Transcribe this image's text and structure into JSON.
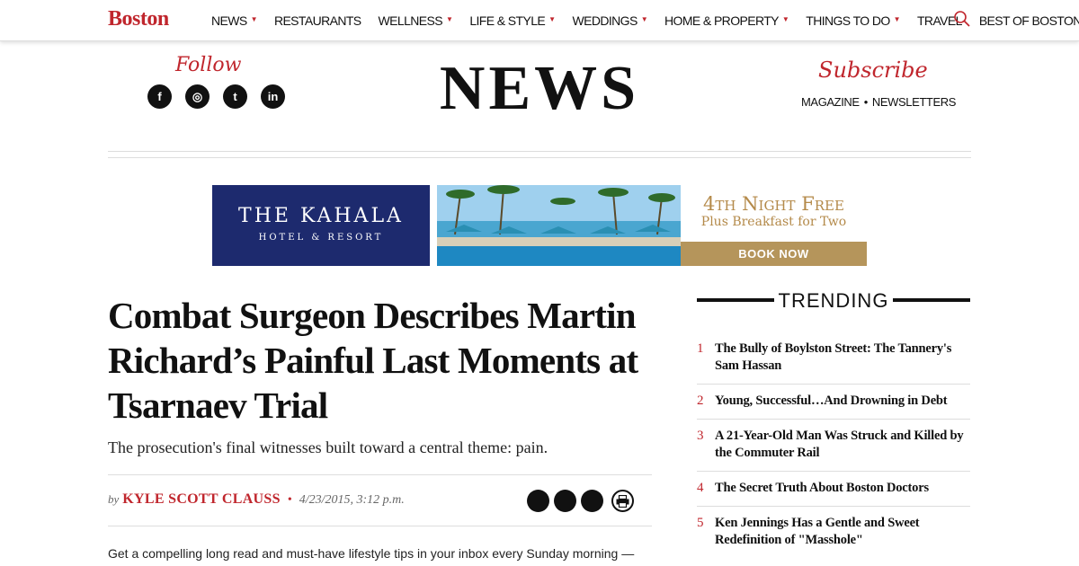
{
  "nav": {
    "logo": "Boston",
    "items": [
      {
        "label": "NEWS",
        "dropdown": true
      },
      {
        "label": "RESTAURANTS",
        "dropdown": false
      },
      {
        "label": "WELLNESS",
        "dropdown": true
      },
      {
        "label": "LIFE & STYLE",
        "dropdown": true
      },
      {
        "label": "WEDDINGS",
        "dropdown": true
      },
      {
        "label": "HOME & PROPERTY",
        "dropdown": true
      },
      {
        "label": "THINGS TO DO",
        "dropdown": true
      },
      {
        "label": "TRAVEL",
        "dropdown": false
      },
      {
        "label": "BEST OF BOSTON",
        "dropdown": false
      }
    ],
    "search_icon": "search-icon",
    "accent_color": "#c0262d"
  },
  "header": {
    "follow_label": "Follow",
    "social": [
      {
        "icon": "facebook-icon",
        "glyph": "f"
      },
      {
        "icon": "instagram-icon",
        "glyph": "◎"
      },
      {
        "icon": "twitter-icon",
        "glyph": "t"
      },
      {
        "icon": "linkedin-icon",
        "glyph": "in"
      }
    ],
    "section_title": "NEWS",
    "subscribe_label": "Subscribe",
    "subscribe_links": [
      "MAGAZINE",
      "NEWSLETTERS"
    ],
    "subscribe_separator": "•"
  },
  "ad": {
    "brand": "THE KAHALA",
    "brand_sub": "HOTEL & RESORT",
    "offer": "4th Night Free",
    "offer_sub": "Plus Breakfast for Two",
    "cta": "BOOK NOW",
    "brand_bg": "#1d2a6e",
    "gold": "#b5955b"
  },
  "article": {
    "headline": "Combat Surgeon Describes Martin Richard’s Painful Last Moments at Tsarnaev Trial",
    "dek": "The prosecution's final witnesses built toward a central theme: pain.",
    "byline_prefix": "by",
    "author": "KYLE SCOTT CLAUSS",
    "separator": "•",
    "timestamp": "4/23/2015, 3:12 p.m.",
    "share_icons": [
      "facebook-share-icon",
      "twitter-share-icon",
      "email-share-icon",
      "print-icon"
    ],
    "promo_text": "Get a compelling long read and must-have lifestyle tips in your inbox every Sunday morning —"
  },
  "trending": {
    "title": "TRENDING",
    "items": [
      {
        "num": "1",
        "title": "The Bully of Boylston Street: The Tannery's Sam Hassan"
      },
      {
        "num": "2",
        "title": "Young, Successful…And Drowning in Debt"
      },
      {
        "num": "3",
        "title": "A 21-Year-Old Man Was Struck and Killed by the Commuter Rail"
      },
      {
        "num": "4",
        "title": "The Secret Truth About Boston Doctors"
      },
      {
        "num": "5",
        "title": "Ken Jennings Has a Gentle and Sweet Redefinition of \"Masshole\""
      }
    ]
  }
}
